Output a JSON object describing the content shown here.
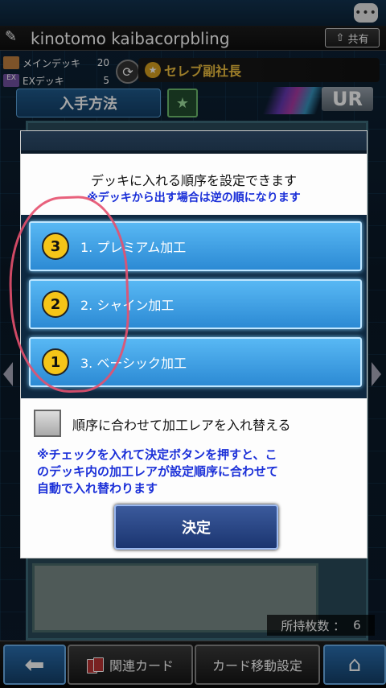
{
  "header": {
    "player_name": "kinotomo kaibacorpbling",
    "share_label": "共有",
    "chat_dots": "•••"
  },
  "decks": [
    {
      "name": "メインデッキ",
      "count": "20",
      "color": "#c08040"
    },
    {
      "name": "EXデッキ",
      "count": "5",
      "color": "#7050a0"
    }
  ],
  "player_title": "セレブ副社長",
  "tabs": {
    "obtain": "入手方法"
  },
  "card": {
    "rarity": "UR",
    "owned_label": "所持枚数 ：",
    "owned_count": "6"
  },
  "dialog": {
    "message": "デッキに入れる順序を設定できます",
    "submessage": "※デッキから出す場合は逆の順になります",
    "options": [
      {
        "badge": "3",
        "label": "1. プレミアム加工"
      },
      {
        "badge": "2",
        "label": "2. シャイン加工"
      },
      {
        "badge": "1",
        "label": "3. ベーシック加工"
      }
    ],
    "checkbox_label": "順序に合わせて加工レアを入れ替える",
    "note_lines": [
      "※チェックを入れて決定ボタンを押すと、こ",
      "のデッキ内の加工レアが設定順序に合わせて",
      "自動で入れ替わります"
    ],
    "confirm_label": "決定"
  },
  "bottom": {
    "related_label": "関連カード",
    "move_label": "カード移動設定"
  },
  "colors": {
    "accent_blue": "#2c8ad4",
    "note_blue": "#1a2fd8",
    "badge_yellow": "#f5c518",
    "annotation_red": "#e6506e"
  }
}
